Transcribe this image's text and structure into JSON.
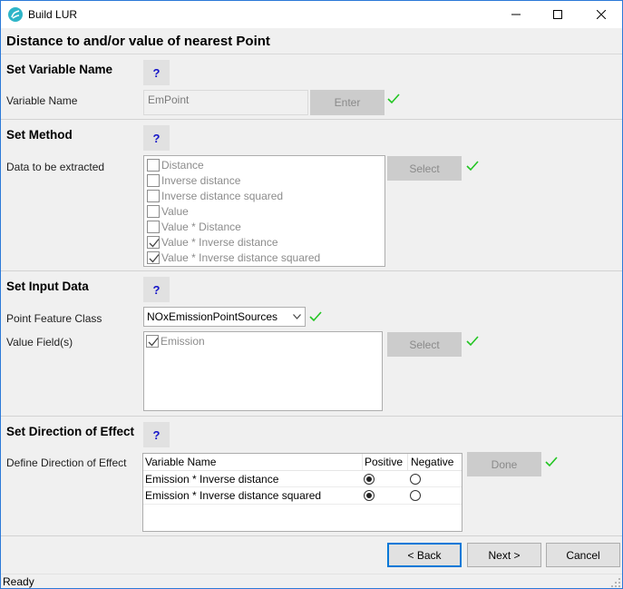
{
  "window": {
    "title": "Build LUR",
    "minimize_label": "Minimize",
    "maximize_label": "Maximize",
    "close_label": "Close"
  },
  "header": {
    "title": "Distance to and/or value of nearest Point"
  },
  "help_label": "?",
  "sections": {
    "variable_name": {
      "title": "Set Variable Name",
      "label": "Variable Name",
      "value": "EmPoint",
      "button": "Enter"
    },
    "method": {
      "title": "Set Method",
      "label": "Data to be extracted",
      "button": "Select",
      "options": [
        {
          "label": "Distance",
          "checked": false
        },
        {
          "label": "Inverse distance",
          "checked": false
        },
        {
          "label": "Inverse distance squared",
          "checked": false
        },
        {
          "label": "Value",
          "checked": false
        },
        {
          "label": "Value * Distance",
          "checked": false
        },
        {
          "label": "Value * Inverse distance",
          "checked": true
        },
        {
          "label": "Value * Inverse distance squared",
          "checked": true
        }
      ]
    },
    "input_data": {
      "title": "Set Input Data",
      "feature_label": "Point Feature Class",
      "feature_value": "NOxEmissionPointSources",
      "fields_label": "Value Field(s)",
      "button": "Select",
      "fields": [
        {
          "label": "Emission",
          "checked": true
        }
      ]
    },
    "direction": {
      "title": "Set Direction of Effect",
      "label": "Define Direction of Effect",
      "button": "Done",
      "columns": [
        "Variable Name",
        "Positive",
        "Negative"
      ],
      "rows": [
        {
          "name": "Emission * Inverse distance",
          "selection": "Positive"
        },
        {
          "name": "Emission * Inverse distance squared",
          "selection": "Positive"
        }
      ]
    }
  },
  "footer": {
    "back": "< Back",
    "next": "Next >",
    "cancel": "Cancel"
  },
  "status": {
    "text": "Ready"
  },
  "colors": {
    "accent": "#0078d7",
    "check": "#22c522",
    "help_text": "#1515c8"
  }
}
